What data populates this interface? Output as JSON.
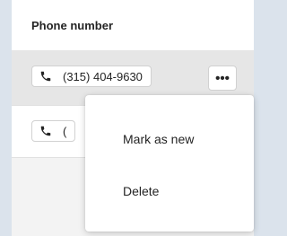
{
  "table": {
    "column_header": "Phone number",
    "rows": [
      {
        "phone": "(315) 404-9630",
        "phone_icon": "phone-icon"
      },
      {
        "phone": "(",
        "phone_icon": "phone-icon"
      }
    ],
    "more_button_label": "•••"
  },
  "context_menu": {
    "items": [
      {
        "label": "Mark as new"
      },
      {
        "label": "Delete"
      }
    ]
  },
  "colors": {
    "background": "#dbe3ec",
    "selected_row": "#e6e6e6",
    "text": "#242424"
  }
}
